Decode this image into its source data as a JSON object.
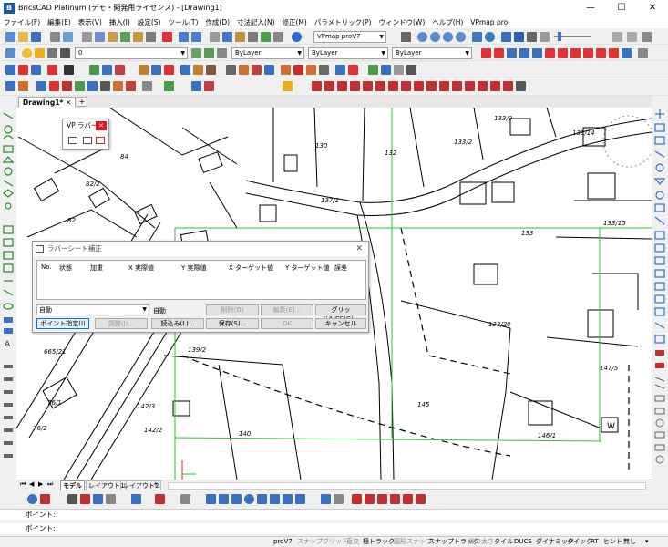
{
  "window": {
    "title": "BricsCAD Platinum (デモ・開発用ライセンス) - [Drawing1]"
  },
  "menu": [
    "ファイル(F)",
    "編集(E)",
    "表示(V)",
    "挿入(I)",
    "設定(S)",
    "ツール(T)",
    "作成(D)",
    "寸法記入(N)",
    "修正(M)",
    "パラメトリック(P)",
    "ウィンドウ(W)",
    "ヘルプ(H)",
    "VPmap pro"
  ],
  "toolbar": {
    "vpmap_combo": "VPmap proV7",
    "layer_combo": "0",
    "color_combo": "ByLayer",
    "linetype_combo": "ByLayer",
    "lineweight_combo": "ByLayer"
  },
  "tabs": {
    "drawing": "Drawing1*",
    "add": "+"
  },
  "vp_panel": {
    "title": "VP ラバー..."
  },
  "rubber_dialog": {
    "title": "ラバーシート補正",
    "columns": [
      "No.",
      "状態",
      "加重",
      "X 実際値",
      "Y 実際値",
      "X ターゲット値",
      "Y ターゲット値",
      "誤差"
    ],
    "mode_select": "自動",
    "mode_label": "自動",
    "buttons": {
      "delete": "削除(D)",
      "edit": "編集(E)...",
      "grid": "グリッド/UCS(G)...",
      "point": "ポイント指定(I)",
      "adjust": "調整(J)...",
      "load": "読込み(L)...",
      "save": "保存(S)...",
      "ok": "OK",
      "cancel": "キャンセル"
    }
  },
  "map_labels": [
    "130",
    "132",
    "133/9",
    "133/2",
    "133/14",
    "137/1",
    "133/15",
    "133",
    "133/20",
    "145",
    "146/1",
    "147/5",
    "140",
    "142/2",
    "142/3",
    "139/2",
    "665/21",
    "76/1",
    "76/2",
    "84",
    "82/2",
    "82",
    "W"
  ],
  "layout_tabs": [
    "モデル",
    "レイアウト1",
    "レイアウト2",
    "+"
  ],
  "command": {
    "prompt1": "ポイント:",
    "prompt2": "ポイント:"
  },
  "status_items": [
    "proV7",
    "スナップ",
    "グリッド",
    "直交",
    "極トラック",
    "図形スナップ",
    "スナップトラック",
    "線の太さ",
    "タイル",
    "DUCS",
    "ダイナミック",
    "クイック",
    "RT",
    "ヒント",
    "無し"
  ]
}
